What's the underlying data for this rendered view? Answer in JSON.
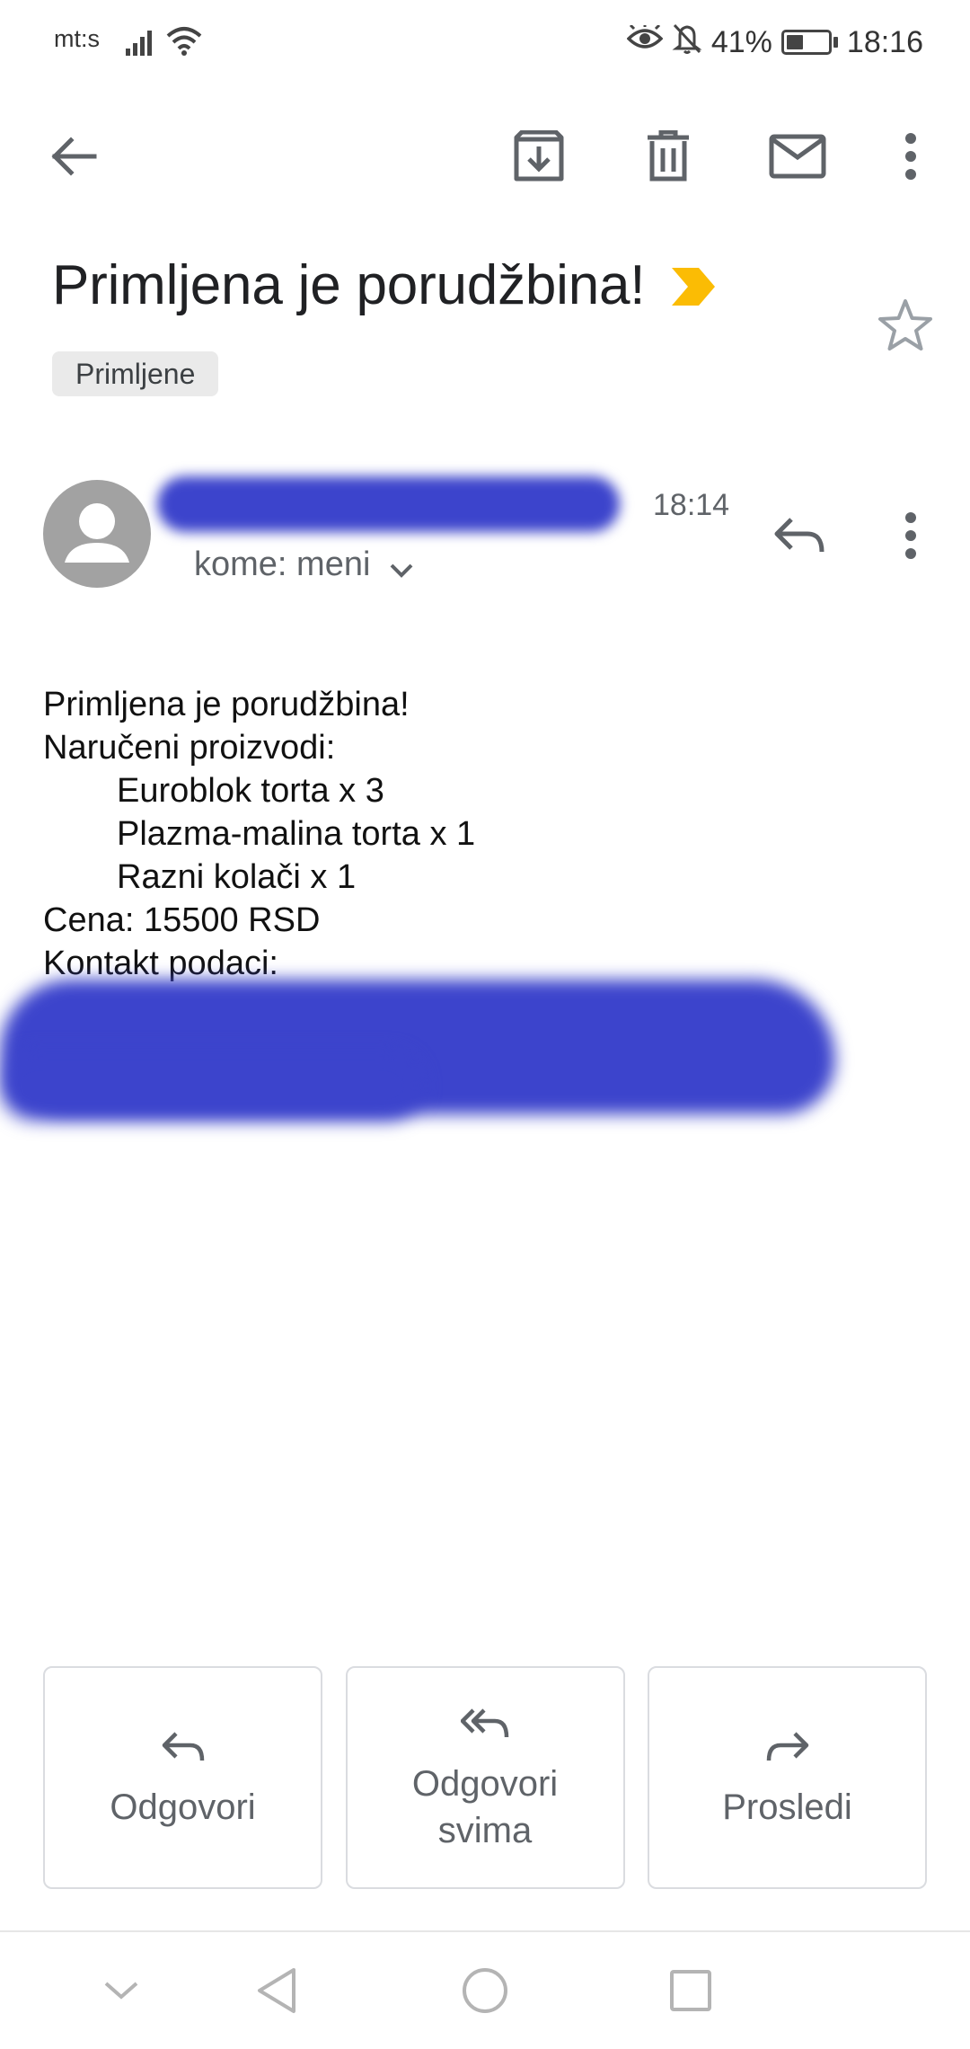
{
  "status_bar": {
    "carrier": "mt:s",
    "battery_percent": "41%",
    "battery_level": 0.41,
    "time": "18:16",
    "icons": [
      "signal-icon",
      "wifi-icon",
      "eye-icon",
      "bell-off-icon",
      "battery-icon"
    ]
  },
  "toolbar": {
    "icons": [
      "back-arrow-icon",
      "archive-icon",
      "delete-icon",
      "mark-unread-icon",
      "more-vert-icon"
    ]
  },
  "email": {
    "subject": "Primljena je porudžbina!",
    "importance_color": "#fbbc04",
    "label": "Primljene",
    "time": "18:14",
    "recipient": "kome: meni",
    "body": {
      "line1": "Primljena je porudžbina!",
      "line2": "Naručeni proizvodi:",
      "item1": "Euroblok torta x 3",
      "item2": "Plazma-malina torta x 1",
      "item3": "Razni kolači x 1",
      "price": "Cena: 15500 RSD",
      "contact": "Kontakt podaci:"
    }
  },
  "actions": {
    "reply": "Odgovori",
    "reply_all": "Odgovori svima",
    "forward": "Prosledi"
  },
  "colors": {
    "redaction": "#3c44cc",
    "icon_gray": "#5f6368",
    "chip_bg": "#eaeaea"
  }
}
